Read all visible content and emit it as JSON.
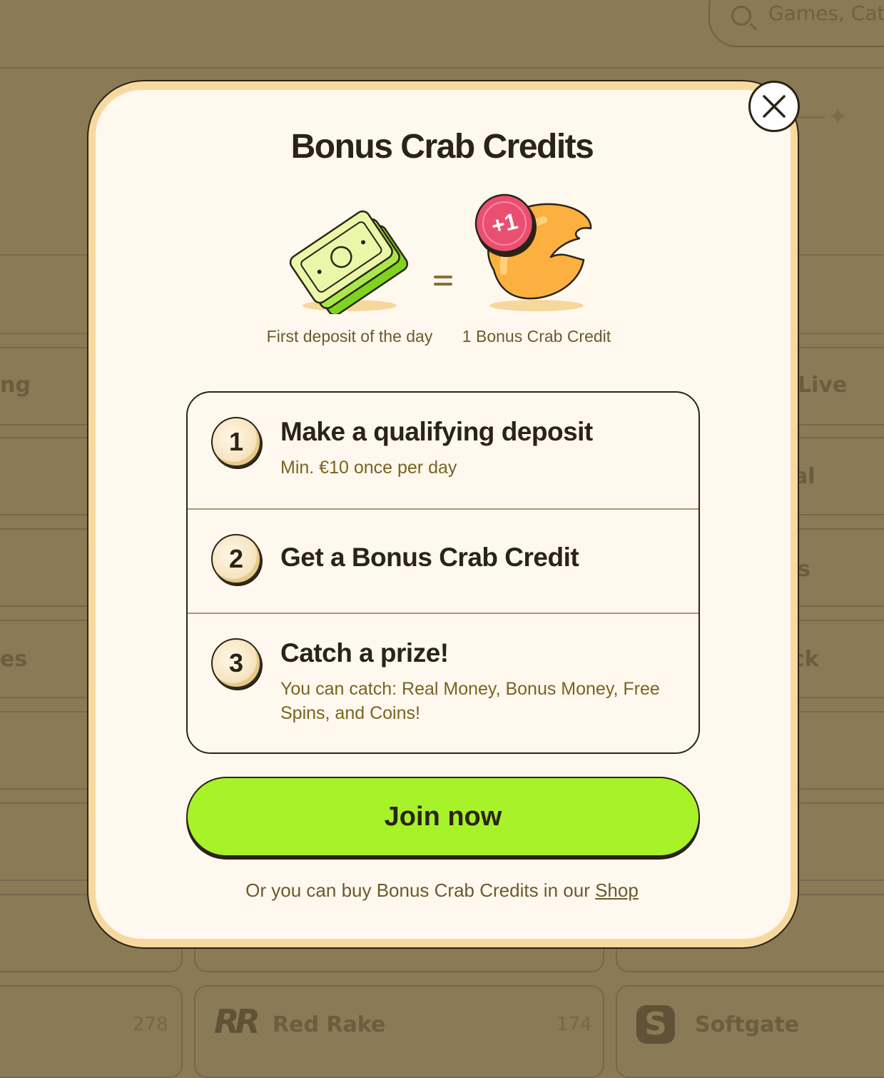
{
  "background": {
    "search_placeholder": "Games, Cate",
    "side_labels": [
      "ng",
      "es",
      "Live",
      "al",
      "s",
      "ck"
    ],
    "providers": [
      {
        "name": "Red Rake",
        "count": "174",
        "logo": "RR"
      },
      {
        "name": "Softgate",
        "logo": "S"
      }
    ],
    "left_count": "278"
  },
  "modal": {
    "title": "Bonus Crab Credits",
    "illustration": {
      "left_label": "First deposit of the day",
      "right_label": "1 Bonus Crab Credit",
      "badge": "+1",
      "left_icon": "money-stack-icon",
      "right_icon": "crab-claw-icon"
    },
    "steps": [
      {
        "number": "1",
        "title": "Make a qualifying deposit",
        "subtitle": "Min. €10 once per day"
      },
      {
        "number": "2",
        "title": "Get a Bonus Crab Credit",
        "subtitle": ""
      },
      {
        "number": "3",
        "title": "Catch a prize!",
        "subtitle": "You can catch: Real Money, Bonus Money, Free Spins, and Coins!"
      }
    ],
    "join_label": "Join now",
    "footer_text": "Or you can buy Bonus Crab Credits in our",
    "footer_link": "Shop"
  },
  "colors": {
    "overlay": "#8a7a55",
    "modal_bg": "#fff8ee",
    "modal_border": "#f7d9a0",
    "join_button": "#a8f22a",
    "text_dark": "#2b2416",
    "text_muted": "#6b5a2e"
  }
}
